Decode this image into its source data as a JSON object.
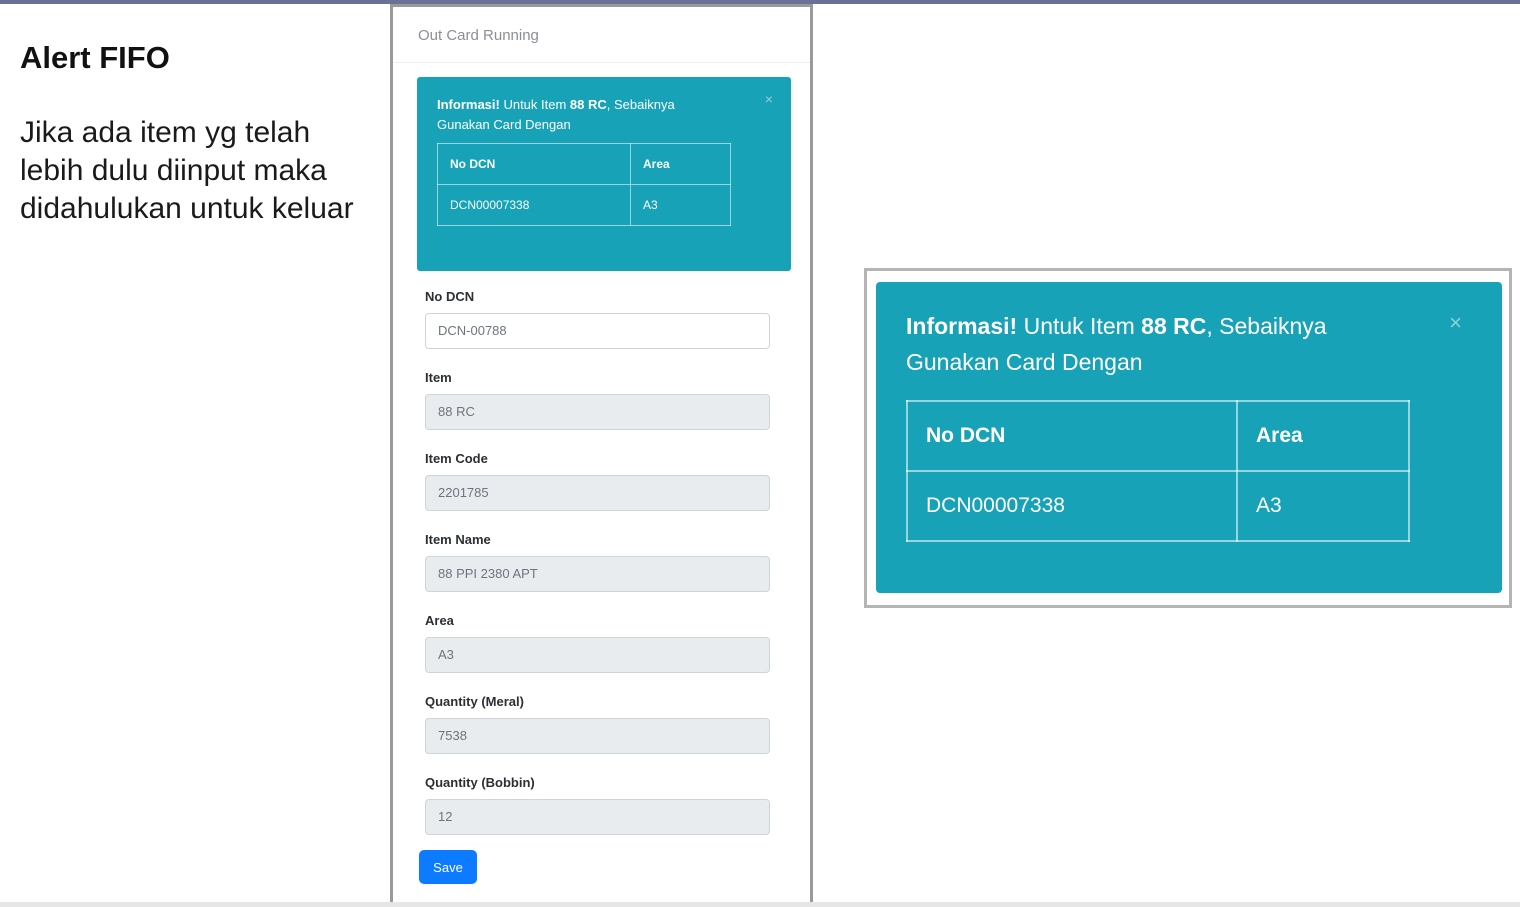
{
  "annotation": {
    "title": "Alert FIFO",
    "body": "Jika ada item yg telah lebih dulu diinput maka didahulukan untuk keluar"
  },
  "frame": {
    "header_title": "Out Card Running"
  },
  "alert": {
    "prefix": "Informasi!",
    "mid": " Untuk Item ",
    "item": "88 RC",
    "suffix": ", Sebaiknya Gunakan Card Dengan",
    "close_symbol": "×",
    "table": {
      "headers": [
        "No DCN",
        "Area"
      ],
      "rows": [
        [
          "DCN00007338",
          "A3"
        ]
      ]
    }
  },
  "form": {
    "fields": [
      {
        "label": "No DCN",
        "value": "DCN-00788",
        "editable": true
      },
      {
        "label": "Item",
        "value": "88 RC",
        "editable": false
      },
      {
        "label": "Item Code",
        "value": "2201785",
        "editable": false
      },
      {
        "label": "Item Name",
        "value": "88 PPI 2380 APT",
        "editable": false
      },
      {
        "label": "Area",
        "value": "A3",
        "editable": false
      },
      {
        "label": "Quantity (Meral)",
        "value": "7538",
        "editable": false
      },
      {
        "label": "Quantity (Bobbin)",
        "value": "12",
        "editable": false
      }
    ],
    "save_label": "Save"
  },
  "colors": {
    "alert_bg": "#17a2b8",
    "primary_button": "#0d7bff",
    "readonly_input": "#e9ecef"
  }
}
